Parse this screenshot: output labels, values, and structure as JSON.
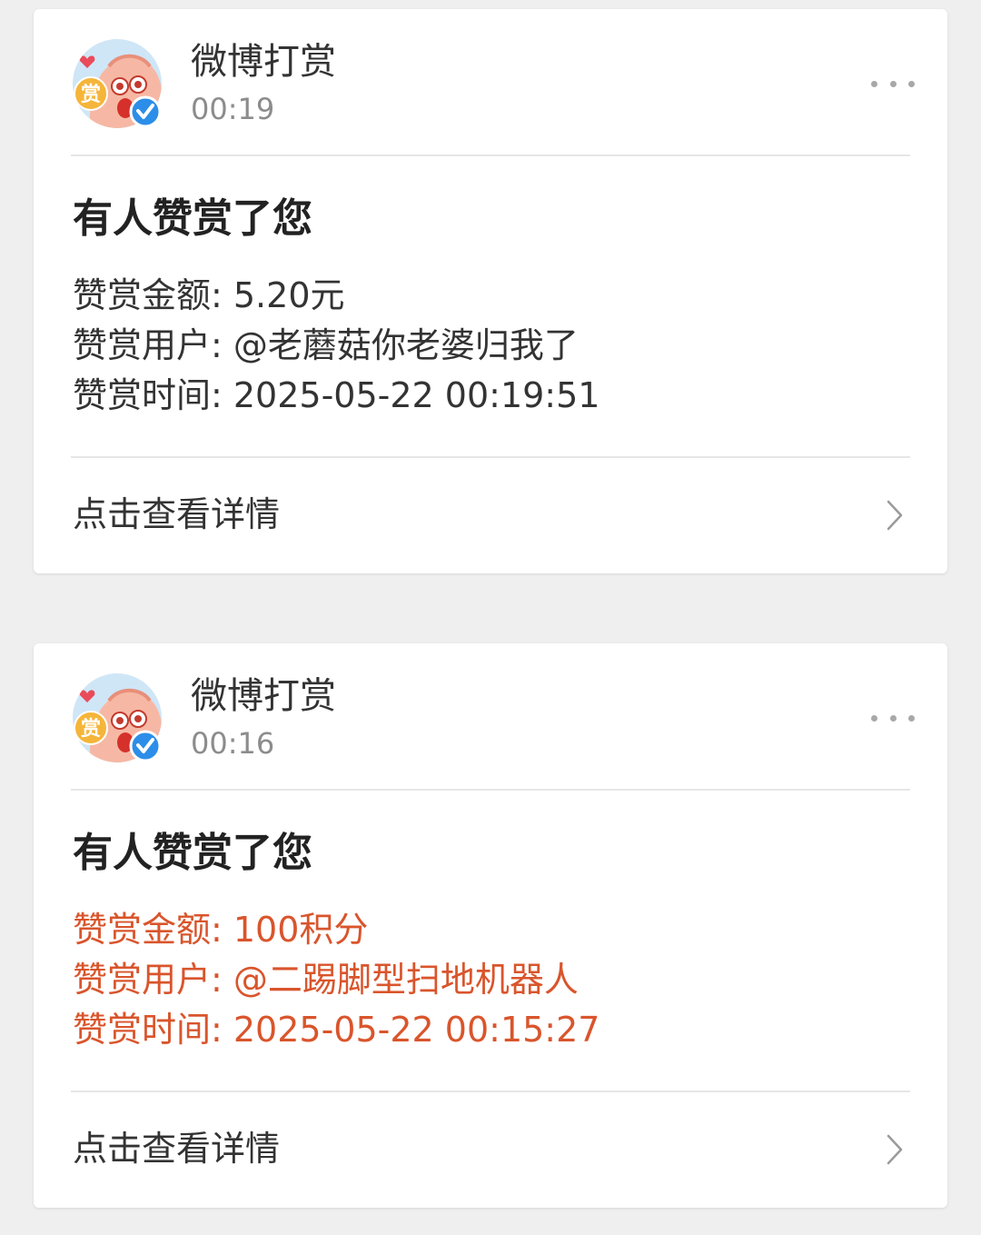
{
  "messages": [
    {
      "sender": {
        "name": "微博打赏",
        "time": "00:19",
        "verified": true
      },
      "title": "有人赞赏了您",
      "lines": [
        "赞赏金额: 5.20元",
        "赞赏用户: @老蘑菇你老婆归我了",
        "赞赏时间: 2025-05-22 00:19:51"
      ],
      "highlight": false,
      "view_detail_label": "点击查看详情"
    },
    {
      "sender": {
        "name": "微博打赏",
        "time": "00:16",
        "verified": true
      },
      "title": "有人赞赏了您",
      "lines": [
        "赞赏金额: 100积分",
        "赞赏用户: @二踢脚型扫地机器人",
        "赞赏时间: 2025-05-22 00:15:27"
      ],
      "highlight": true,
      "view_detail_label": "点击查看详情"
    }
  ],
  "avatar_badge_text": "赏",
  "colors": {
    "background": "#efefef",
    "card": "#ffffff",
    "highlight_text": "#d9552c",
    "verified_badge": "#2c8ee8",
    "avatar_badge": "#f5b53a"
  }
}
